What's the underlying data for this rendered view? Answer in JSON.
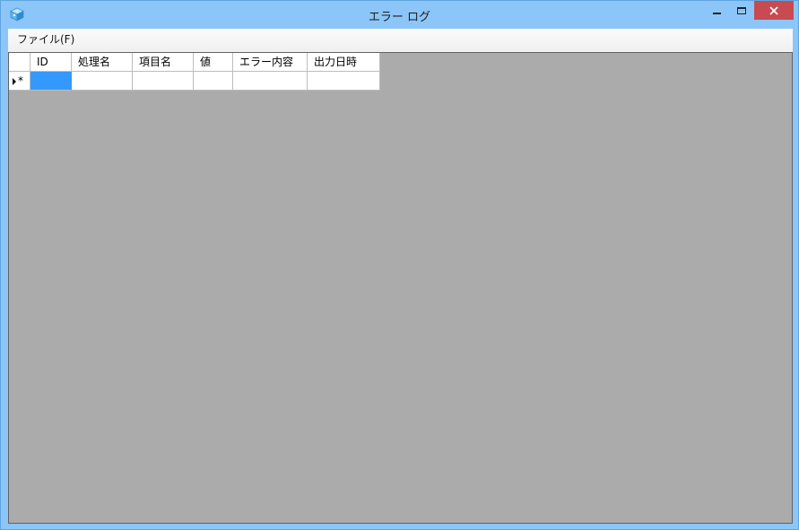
{
  "window": {
    "title": "エラー ログ"
  },
  "menu": {
    "items": [
      {
        "label": "ファイル(F)"
      }
    ]
  },
  "grid": {
    "columns": [
      {
        "label": "ID"
      },
      {
        "label": "処理名"
      },
      {
        "label": "項目名"
      },
      {
        "label": "値"
      },
      {
        "label": "エラー内容"
      },
      {
        "label": "出力日時"
      }
    ],
    "new_row_marker": "*",
    "rows": [
      {
        "cells": [
          "",
          "",
          "",
          "",
          "",
          ""
        ]
      }
    ]
  },
  "colors": {
    "title_bar": "#8cc6f8",
    "close_button": "#c74b50",
    "grid_background": "#ababab",
    "selected_cell": "#3399ff"
  },
  "icons": {
    "app": "cube-app-icon",
    "minimize": "minimize-icon",
    "maximize": "maximize-icon",
    "close": "close-icon",
    "current_row": "row-pointer-icon"
  }
}
